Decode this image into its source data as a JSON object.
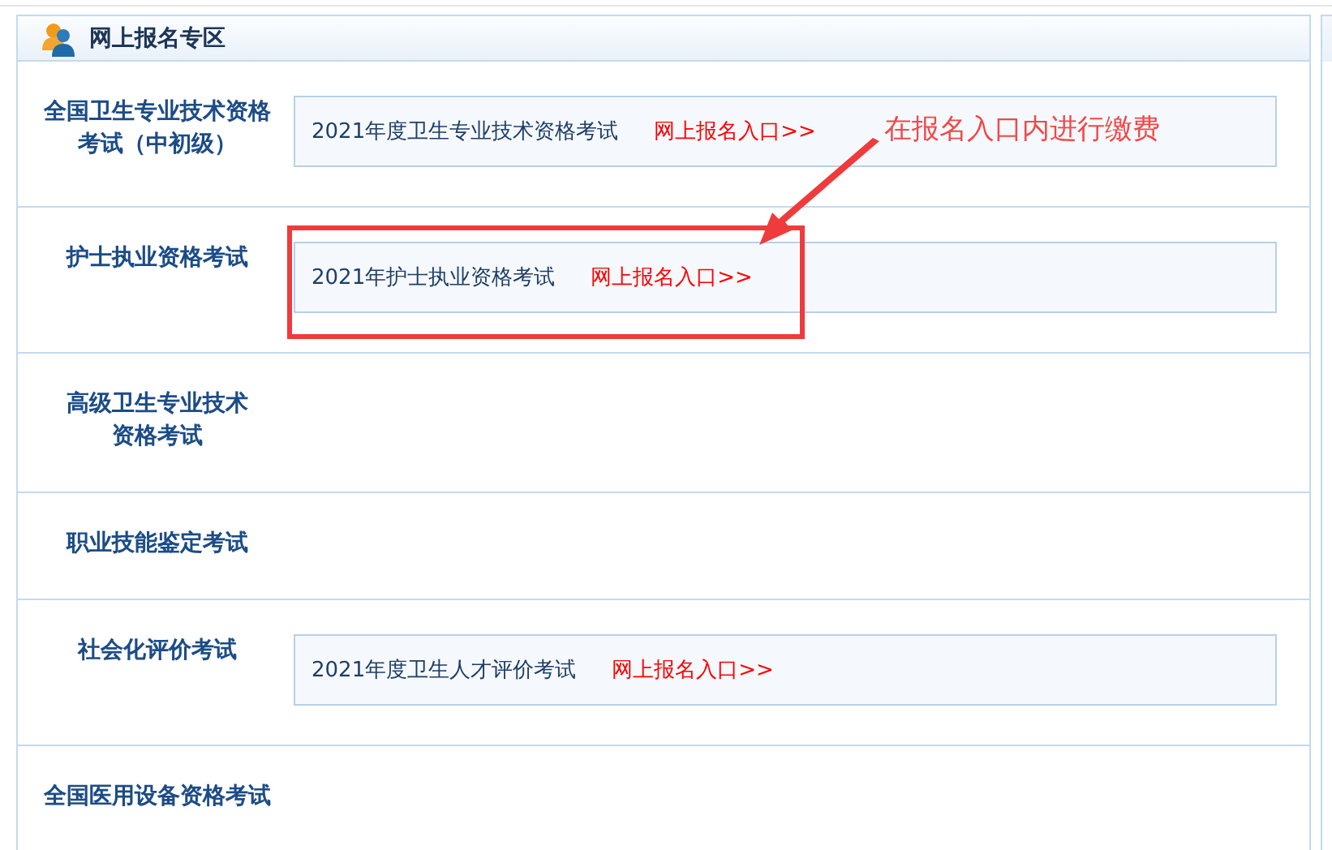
{
  "panel": {
    "title": "网上报名专区"
  },
  "rows": [
    {
      "label_lines": [
        "全国卫生专业技术资格",
        "考试（中初级）"
      ],
      "entries": [
        {
          "exam": "2021年度卫生专业技术资格考试",
          "link": "网上报名入口>>"
        }
      ]
    },
    {
      "label_lines": [
        "护士执业资格考试"
      ],
      "highlighted": true,
      "entries": [
        {
          "exam": "2021年护士执业资格考试",
          "link": "网上报名入口>>"
        }
      ]
    },
    {
      "label_lines": [
        "高级卫生专业技术",
        "资格考试"
      ],
      "entries": []
    },
    {
      "label_lines": [
        "职业技能鉴定考试"
      ],
      "entries": []
    },
    {
      "label_lines": [
        "社会化评价考试"
      ],
      "entries": [
        {
          "exam": "2021年度卫生人才评价考试",
          "link": "网上报名入口>>"
        }
      ]
    },
    {
      "label_lines": [
        "全国医用设备资格考试"
      ],
      "entries": []
    }
  ],
  "annotation": {
    "text": "在报名入口内进行缴费"
  }
}
